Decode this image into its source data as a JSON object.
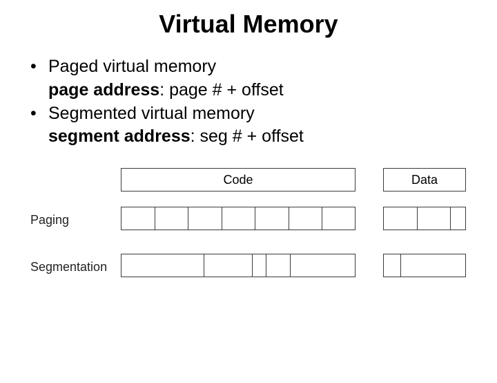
{
  "title": "Virtual Memory",
  "bullets": {
    "b1": "Paged virtual memory",
    "b1_sub_label": "page address",
    "b1_sub_rest": ": page # + offset",
    "b2": "Segmented virtual memory",
    "b2_sub_label": "segment address",
    "b2_sub_rest": ": seg # + offset"
  },
  "diagram": {
    "top_code": "Code",
    "top_data": "Data",
    "row_paging": "Paging",
    "row_segmentation": "Segmentation"
  }
}
